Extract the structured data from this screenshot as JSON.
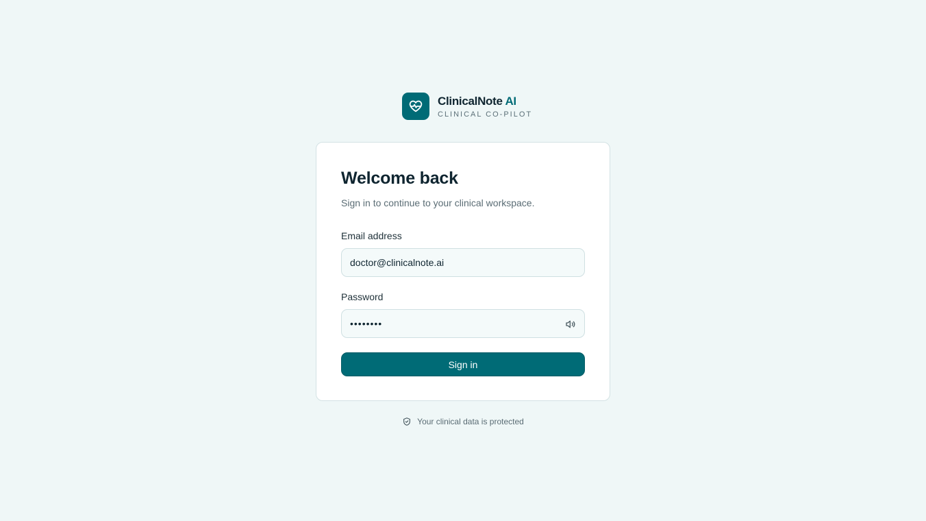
{
  "brand": {
    "name": "ClinicalNote",
    "accent": "AI",
    "tagline": "CLINICAL CO-PILOT",
    "logo_icon": "heart-pulse-icon",
    "color": "#006b76"
  },
  "login": {
    "title": "Welcome back",
    "subtitle": "Sign in to continue to your clinical workspace.",
    "email_label": "Email address",
    "email_value": "doctor@clinicalnote.ai",
    "password_label": "Password",
    "password_value": "••••••••",
    "password_toggle_icon": "speaker-icon",
    "submit_label": "Sign in"
  },
  "footer": {
    "icon": "shield-check-icon",
    "text": "Your clinical data is protected"
  }
}
